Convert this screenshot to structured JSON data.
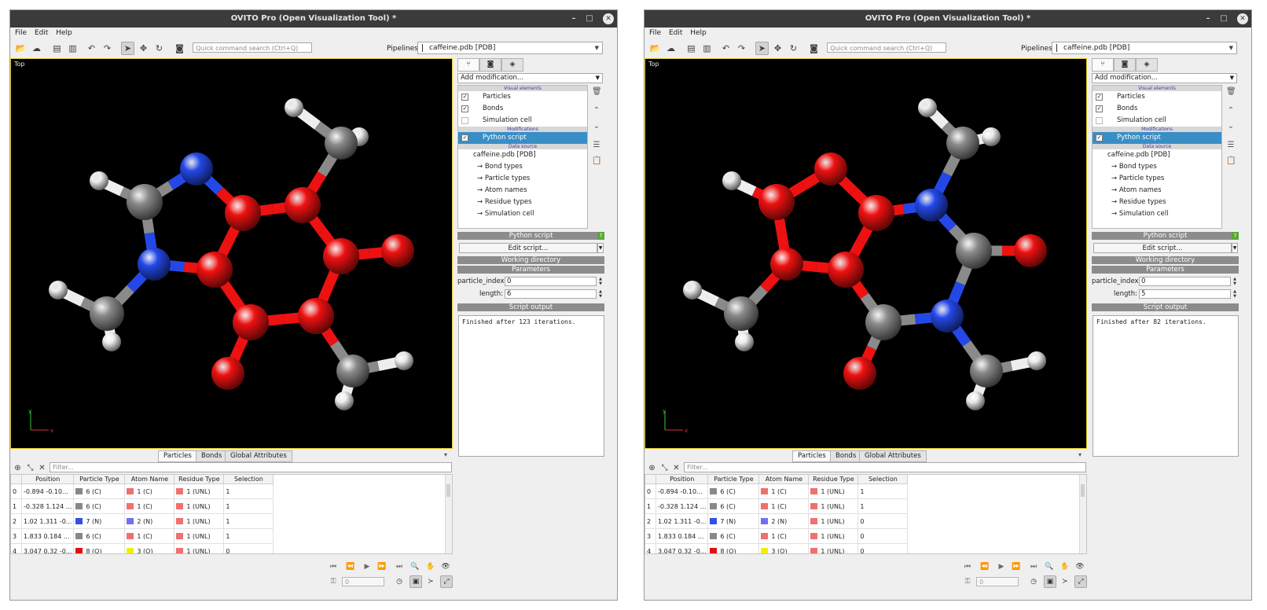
{
  "windows": [
    {
      "title": "OVITO Pro (Open Visualization Tool) *",
      "menu": [
        "File",
        "Edit",
        "Help"
      ],
      "search_placeholder": "Quick command search (Ctrl+Q)",
      "pipelines_label": "Pipelines:",
      "pipeline_selected": "caffeine.pdb [PDB]",
      "viewport_caption": "Top",
      "axis_x": "x",
      "axis_y": "y",
      "tabs": [
        "Particles",
        "Bonds",
        "Global Attributes"
      ],
      "filter_placeholder": "Filter...",
      "table_headers": [
        "Position",
        "Particle Type",
        "Atom Name",
        "Residue Type",
        "Selection"
      ],
      "table_rows": [
        {
          "idx": "0",
          "pos": "-0.894 -0.10...",
          "ptype": "6 (C)",
          "ptype_color": "#888888",
          "aname": "1 (C)",
          "aname_color": "#f07070",
          "rtype": "1 (UNL)",
          "rtype_color": "#f07070",
          "sel": "1"
        },
        {
          "idx": "1",
          "pos": "-0.328 1.124 ...",
          "ptype": "6 (C)",
          "ptype_color": "#888888",
          "aname": "1 (C)",
          "aname_color": "#f07070",
          "rtype": "1 (UNL)",
          "rtype_color": "#f07070",
          "sel": "1"
        },
        {
          "idx": "2",
          "pos": "1.02 1.311 -0...",
          "ptype": "7 (N)",
          "ptype_color": "#3350e6",
          "aname": "2 (N)",
          "aname_color": "#7070f0",
          "rtype": "1 (UNL)",
          "rtype_color": "#f07070",
          "sel": "1"
        },
        {
          "idx": "3",
          "pos": "1.833 0.184 ...",
          "ptype": "6 (C)",
          "ptype_color": "#888888",
          "aname": "1 (C)",
          "aname_color": "#f07070",
          "rtype": "1 (UNL)",
          "rtype_color": "#f07070",
          "sel": "1"
        },
        {
          "idx": "4",
          "pos": "3.047 0.32 -0...",
          "ptype": "8 (O)",
          "ptype_color": "#e01010",
          "aname": "3 (O)",
          "aname_color": "#f0f000",
          "rtype": "1 (UNL)",
          "rtype_color": "#f07070",
          "sel": "0"
        }
      ],
      "frame_value": "0",
      "add_modification": "Add modification...",
      "section_visual": "Visual elements",
      "section_mod": "Modifications",
      "section_source": "Data source",
      "visual_elements": [
        {
          "label": "Particles",
          "checked": true
        },
        {
          "label": "Bonds",
          "checked": true
        },
        {
          "label": "Simulation cell",
          "checked": false
        }
      ],
      "modifier": "Python script",
      "data_source": "caffeine.pdb [PDB]",
      "source_items": [
        "→ Bond types",
        "→ Particle types",
        "→ Atom names",
        "→ Residue types",
        "→ Simulation cell"
      ],
      "rollout_python": "Python script",
      "rollout_help": "?",
      "edit_script": "Edit script...",
      "rollout_workdir": "Working directory",
      "rollout_params": "Parameters",
      "param_index_label": "particle_index:",
      "param_index_value": "0",
      "param_length_label": "length:",
      "param_length_value": "6",
      "rollout_output": "Script output",
      "script_output": "Finished after 123 iterations.",
      "mol_variant": "left"
    },
    {
      "title": "OVITO Pro (Open Visualization Tool) *",
      "menu": [
        "File",
        "Edit",
        "Help"
      ],
      "search_placeholder": "Quick command search (Ctrl+Q)",
      "pipelines_label": "Pipelines:",
      "pipeline_selected": "caffeine.pdb [PDB]",
      "viewport_caption": "Top",
      "axis_x": "x",
      "axis_y": "y",
      "tabs": [
        "Particles",
        "Bonds",
        "Global Attributes"
      ],
      "filter_placeholder": "Filter...",
      "table_headers": [
        "Position",
        "Particle Type",
        "Atom Name",
        "Residue Type",
        "Selection"
      ],
      "table_rows": [
        {
          "idx": "0",
          "pos": "-0.894 -0.10...",
          "ptype": "6 (C)",
          "ptype_color": "#888888",
          "aname": "1 (C)",
          "aname_color": "#f07070",
          "rtype": "1 (UNL)",
          "rtype_color": "#f07070",
          "sel": "1"
        },
        {
          "idx": "1",
          "pos": "-0.328 1.124 ...",
          "ptype": "6 (C)",
          "ptype_color": "#888888",
          "aname": "1 (C)",
          "aname_color": "#f07070",
          "rtype": "1 (UNL)",
          "rtype_color": "#f07070",
          "sel": "1"
        },
        {
          "idx": "2",
          "pos": "1.02 1.311 -0...",
          "ptype": "7 (N)",
          "ptype_color": "#3350e6",
          "aname": "2 (N)",
          "aname_color": "#7070f0",
          "rtype": "1 (UNL)",
          "rtype_color": "#f07070",
          "sel": "0"
        },
        {
          "idx": "3",
          "pos": "1.833 0.184 ...",
          "ptype": "6 (C)",
          "ptype_color": "#888888",
          "aname": "1 (C)",
          "aname_color": "#f07070",
          "rtype": "1 (UNL)",
          "rtype_color": "#f07070",
          "sel": "0"
        },
        {
          "idx": "4",
          "pos": "3.047 0.32 -0...",
          "ptype": "8 (O)",
          "ptype_color": "#e01010",
          "aname": "3 (O)",
          "aname_color": "#f0f000",
          "rtype": "1 (UNL)",
          "rtype_color": "#f07070",
          "sel": "0"
        }
      ],
      "frame_value": "0",
      "add_modification": "Add modification...",
      "section_visual": "Visual elements",
      "section_mod": "Modifications",
      "section_source": "Data source",
      "visual_elements": [
        {
          "label": "Particles",
          "checked": true
        },
        {
          "label": "Bonds",
          "checked": true
        },
        {
          "label": "Simulation cell",
          "checked": false
        }
      ],
      "modifier": "Python script",
      "data_source": "caffeine.pdb [PDB]",
      "source_items": [
        "→ Bond types",
        "→ Particle types",
        "→ Atom names",
        "→ Residue types",
        "→ Simulation cell"
      ],
      "rollout_python": "Python script",
      "rollout_help": "?",
      "edit_script": "Edit script...",
      "rollout_workdir": "Working directory",
      "rollout_params": "Parameters",
      "param_index_label": "particle_index:",
      "param_index_value": "0",
      "param_length_label": "length:",
      "param_length_value": "5",
      "rollout_output": "Script output",
      "script_output": "Finished after 82 iterations.",
      "mol_variant": "right"
    }
  ],
  "colors": {
    "selected_atom": "#ee1111",
    "carbon": "#8a8a8a",
    "nitrogen": "#2448e8",
    "oxygen": "#ee1111",
    "hydrogen": "#eeeeee",
    "selection_highlight": "#3a8ec6"
  }
}
